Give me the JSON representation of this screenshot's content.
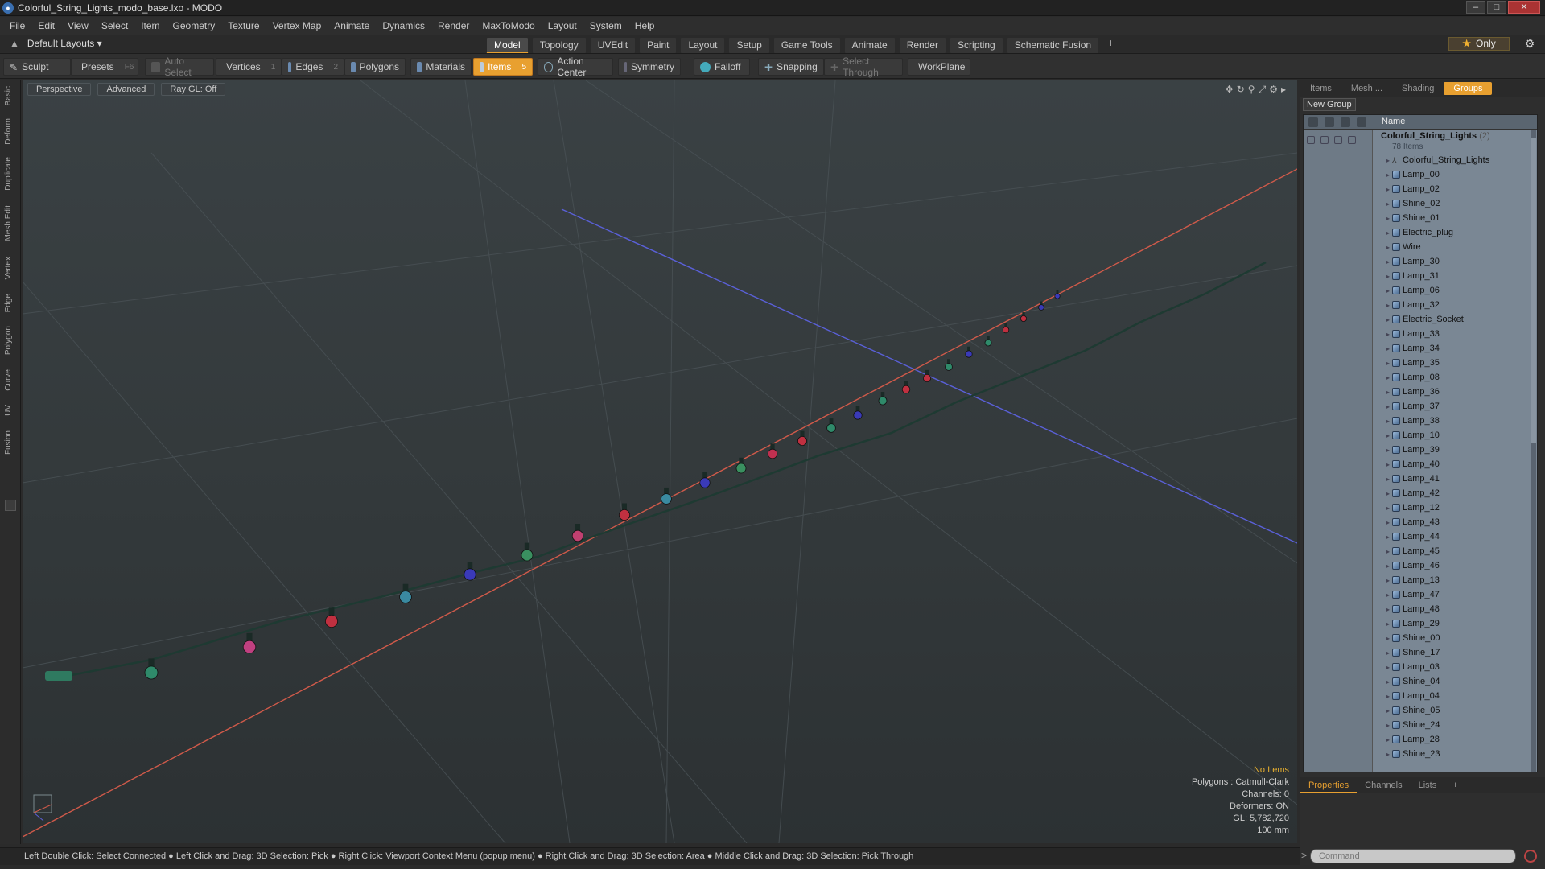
{
  "window": {
    "title": "Colorful_String_Lights_modo_base.lxo - MODO",
    "app_icon": "modo-icon"
  },
  "menu": [
    "File",
    "Edit",
    "View",
    "Select",
    "Item",
    "Geometry",
    "Texture",
    "Vertex Map",
    "Animate",
    "Dynamics",
    "Render",
    "MaxToModo",
    "Layout",
    "System",
    "Help"
  ],
  "layoutbar": {
    "layout_label": "Default Layouts",
    "tabs": [
      "Model",
      "Topology",
      "UVEdit",
      "Paint",
      "Layout",
      "Setup",
      "Game Tools",
      "Animate",
      "Render",
      "Scripting",
      "Schematic Fusion"
    ],
    "active_tab": "Model",
    "plus": "+",
    "only_label": "Only"
  },
  "toolbar": {
    "sculpt": "Sculpt",
    "presets": "Presets",
    "presets_key": "F6",
    "auto_select": "Auto Select",
    "vertices": "Vertices",
    "vertices_key": "1",
    "edges": "Edges",
    "edges_key": "2",
    "polygons": "Polygons",
    "materials": "Materials",
    "items": "Items",
    "items_key": "5",
    "action_center": "Action Center",
    "symmetry": "Symmetry",
    "falloff": "Falloff",
    "snapping": "Snapping",
    "select_through": "Select Through",
    "workplane": "WorkPlane"
  },
  "left_tabs": [
    "Basic",
    "Deform",
    "Duplicate",
    "Mesh Edit",
    "Vertex",
    "Edge",
    "Polygon",
    "Curve",
    "UV",
    "Fusion"
  ],
  "viewport": {
    "view_mode": "Perspective",
    "shading": "Advanced",
    "raygl": "Ray GL: Off",
    "info": {
      "selection": "No Items",
      "polygons": "Polygons : Catmull-Clark",
      "channels": "Channels: 0",
      "deformers": "Deformers: ON",
      "gl": "GL: 5,782,720",
      "scale": "100 mm"
    },
    "bulb_colors": [
      "#2f8a6a",
      "#c04080",
      "#c03040",
      "#3a8aa0",
      "#3a3ab8",
      "#3a9060",
      "#c04070",
      "#c03040",
      "#3a8aa0",
      "#3a3ab8",
      "#3a9060",
      "#c03050",
      "#c03040",
      "#2f8a6a",
      "#3a3ab8",
      "#2f8a6a",
      "#c03040",
      "#c03040",
      "#2f8a6a",
      "#3a3ab8",
      "#2f8a6a",
      "#c03040",
      "#c03040",
      "#3a3ab8",
      "#3a3ab8"
    ]
  },
  "status": "Left Double Click: Select Connected ● Left Click and Drag: 3D Selection: Pick ● Right Click: Viewport Context Menu (popup menu) ● Right Click and Drag: 3D Selection: Area ● Middle Click and Drag: 3D Selection: Pick Through",
  "right_panel": {
    "tabs": [
      "Items",
      "Mesh ...",
      "Shading",
      "Groups"
    ],
    "active_tab": "Groups",
    "new_group": "New Group",
    "name_header": "Name",
    "group": {
      "name": "Colorful_String_Lights",
      "count": "(2)",
      "subtitle": "78 Items"
    },
    "items": [
      "Colorful_String_Lights",
      "Lamp_00",
      "Lamp_02",
      "Shine_02",
      "Shine_01",
      "Electric_plug",
      "Wire",
      "Lamp_30",
      "Lamp_31",
      "Lamp_06",
      "Lamp_32",
      "Electric_Socket",
      "Lamp_33",
      "Lamp_34",
      "Lamp_35",
      "Lamp_08",
      "Lamp_36",
      "Lamp_37",
      "Lamp_38",
      "Lamp_10",
      "Lamp_39",
      "Lamp_40",
      "Lamp_41",
      "Lamp_42",
      "Lamp_12",
      "Lamp_43",
      "Lamp_44",
      "Lamp_45",
      "Lamp_46",
      "Lamp_13",
      "Lamp_47",
      "Lamp_48",
      "Lamp_29",
      "Shine_00",
      "Shine_17",
      "Lamp_03",
      "Shine_04",
      "Lamp_04",
      "Shine_05",
      "Shine_24",
      "Lamp_28",
      "Shine_23"
    ],
    "bottom_tabs": [
      "Properties",
      "Channels",
      "Lists"
    ],
    "bottom_active": "Properties",
    "bottom_plus": "+",
    "command_placeholder": "Command",
    "command_prompt": ">"
  }
}
